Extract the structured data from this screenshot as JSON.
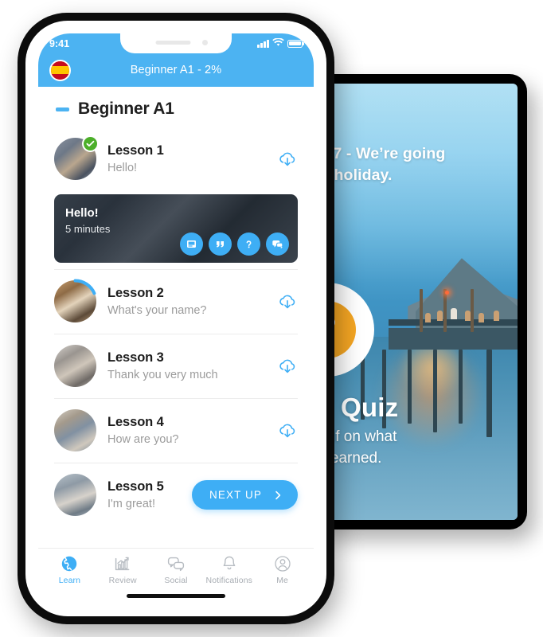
{
  "phone": {
    "status_bar": {
      "time": "9:41",
      "signal_icon": "signal-bars-icon",
      "wifi_icon": "wifi-icon",
      "battery_icon": "battery-full-icon"
    },
    "nav_bar": {
      "flag_icon": "spain-flag-icon",
      "title": "Beginner A1 - 2%"
    },
    "section": {
      "collapse_icon": "collapse-dash-icon",
      "title": "Beginner A1"
    },
    "lessons": [
      {
        "name": "Lesson 1",
        "desc": "Hello!",
        "status": "completed",
        "badge_icon": "check-circle-icon",
        "action_icon": "cloud-download-icon",
        "expanded": true
      },
      {
        "name": "Lesson 2",
        "desc": "What's your name?",
        "status": "in-progress",
        "action_icon": "cloud-download-icon",
        "expanded": false
      },
      {
        "name": "Lesson 3",
        "desc": "Thank you very much",
        "status": "locked",
        "action_icon": "cloud-download-icon",
        "expanded": false
      },
      {
        "name": "Lesson 4",
        "desc": "How are you?",
        "status": "locked",
        "action_icon": "cloud-download-icon",
        "expanded": false
      },
      {
        "name": "Lesson 5",
        "desc": "I'm great!",
        "status": "next",
        "action_label": "NEXT UP",
        "action_icon": "chevron-right-icon",
        "expanded": false
      }
    ],
    "lesson_card": {
      "title": "Hello!",
      "duration": "5 minutes",
      "actions": [
        {
          "icon": "flashcard-icon",
          "name": "vocabulary"
        },
        {
          "icon": "quotes-icon",
          "name": "phrases"
        },
        {
          "icon": "question-icon",
          "name": "quiz"
        },
        {
          "icon": "chat-bubbles-icon",
          "name": "conversation"
        }
      ]
    },
    "tabs": [
      {
        "label": "Learn",
        "icon": "globe-icon",
        "active": true
      },
      {
        "label": "Review",
        "icon": "bar-chart-icon",
        "active": false
      },
      {
        "label": "Social",
        "icon": "chat-bubbles-icon",
        "active": false
      },
      {
        "label": "Notifications",
        "icon": "bell-icon",
        "active": false
      },
      {
        "label": "Me",
        "icon": "person-icon",
        "active": false
      }
    ]
  },
  "tablet": {
    "lesson_title": "n 17 - We’re going\non holiday.",
    "quiz_icon": "question-mark-icon",
    "quiz_title": "Quiz",
    "quiz_subtitle": "yourself on what\nou’ve learned."
  },
  "colors": {
    "brand_blue": "#4cb3f2",
    "accent_blue": "#3eaef5",
    "success_green": "#4caf2a",
    "quiz_orange": "#f5a623",
    "muted_text": "#9b9b9b"
  }
}
